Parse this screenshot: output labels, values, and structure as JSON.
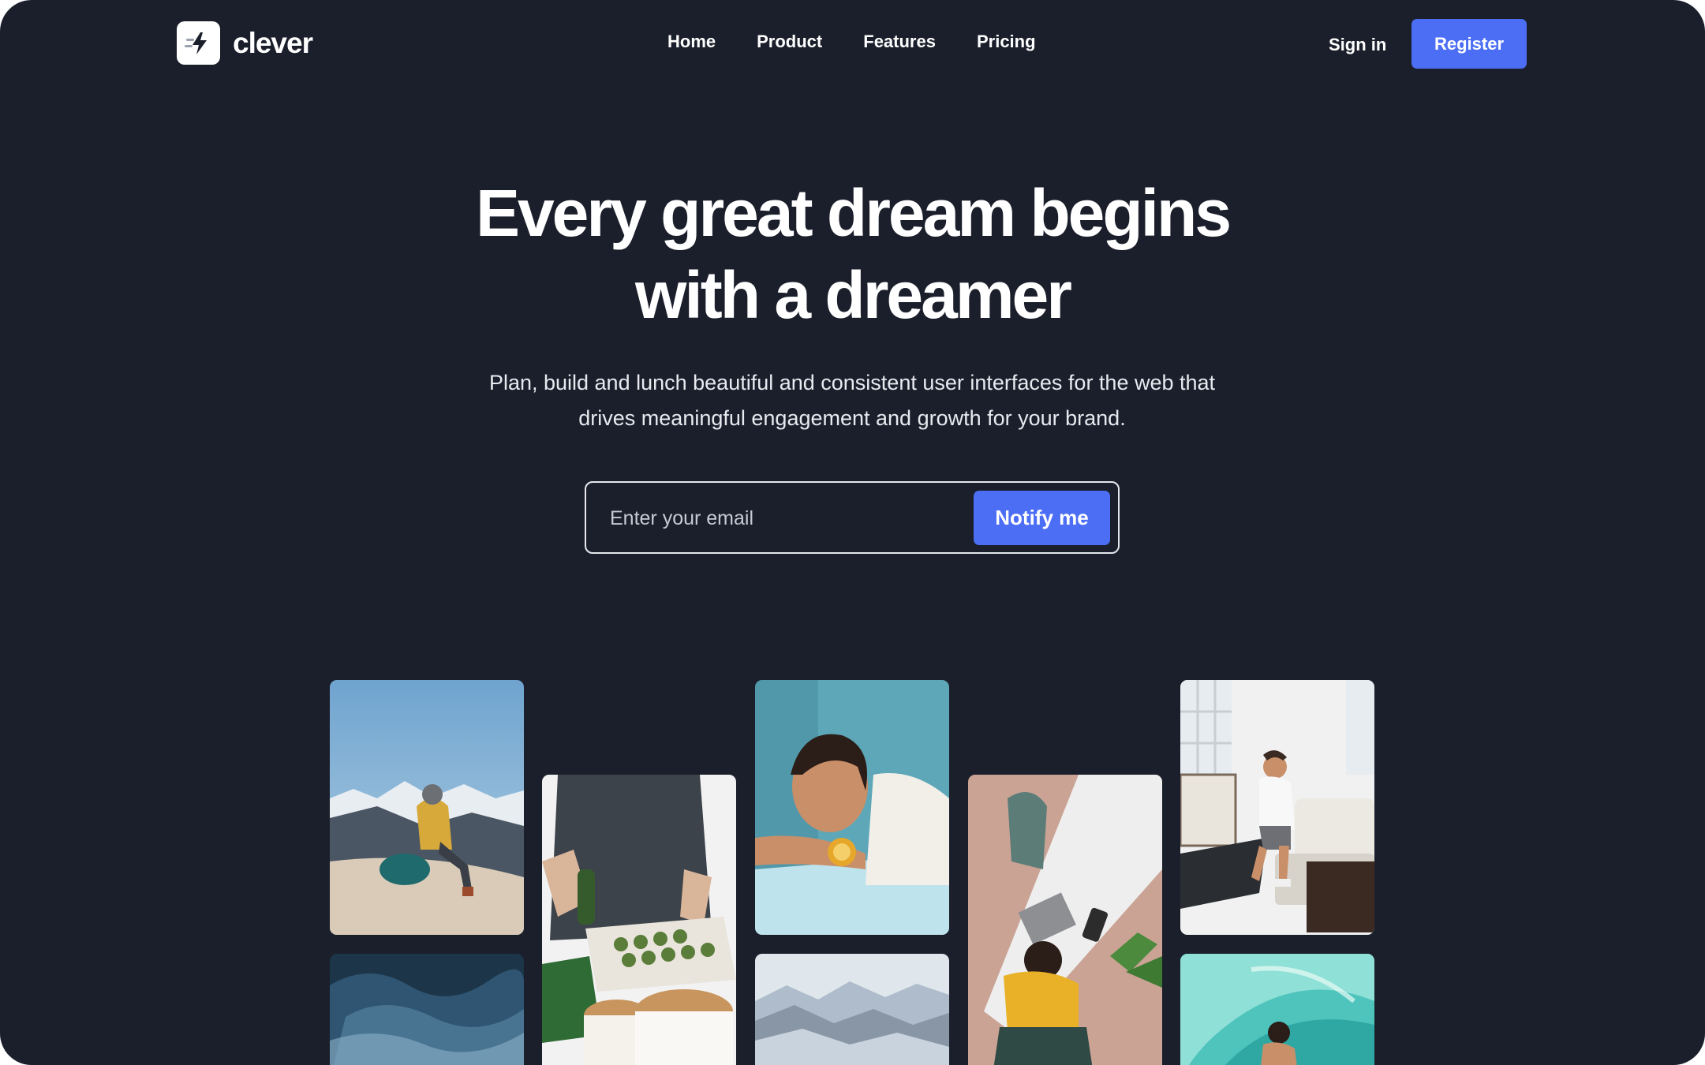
{
  "brand": {
    "name": "clever",
    "logo_icon": "lightning-bolt-icon"
  },
  "nav": {
    "items": [
      {
        "label": "Home"
      },
      {
        "label": "Product"
      },
      {
        "label": "Features"
      },
      {
        "label": "Pricing"
      }
    ]
  },
  "header": {
    "signin_label": "Sign in",
    "register_label": "Register"
  },
  "hero": {
    "headline_line1": "Every great dream begins",
    "headline_line2": "with a dreamer",
    "subtitle_line1": "Plan, build and lunch beautiful and consistent user interfaces for the web that",
    "subtitle_line2": "drives meaningful engagement and growth for your brand."
  },
  "signup": {
    "email_placeholder": "Enter your email",
    "email_value": "",
    "button_label": "Notify me"
  },
  "colors": {
    "background": "#1b1f2b",
    "accent": "#4c6ef5",
    "text": "#ffffff"
  }
}
